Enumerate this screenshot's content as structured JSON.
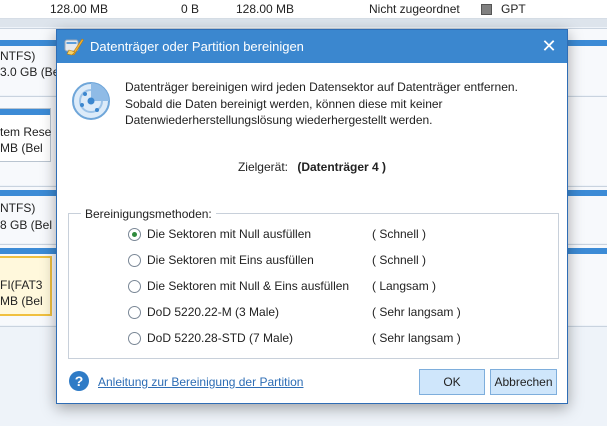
{
  "background": {
    "top_row": {
      "capacity": "128.00 MB",
      "used": "0 B",
      "unused": "128.00 MB",
      "status": "Nicht zugeordnet",
      "type": "GPT"
    },
    "fragments": {
      "ntfs_1": "NTFS)",
      "size_1": "3.0 GB (Bel",
      "reserved": "tem Rese",
      "mb_1": "MB (Bel",
      "ntfs_2": "NTFS)",
      "size_2": "8 GB (Bel",
      "fat": "FI(FAT3",
      "mb_2": "MB (Bel"
    }
  },
  "dialog": {
    "title": "Datenträger oder Partition bereinigen",
    "close_glyph": "✕",
    "message": "Datenträger bereinigen wird jeden Datensektor auf Datenträger entfernen. Sobald die Daten bereinigt werden, können diese mit keiner Datenwiederherstellungslösung wiederhergestellt werden.",
    "target_label": "Zielgerät:",
    "target_value": "(Datenträger 4 )",
    "methods_legend": "Bereinigungsmethoden:",
    "methods": [
      {
        "name": "Die Sektoren mit Null ausfüllen",
        "speed": "( Schnell )",
        "selected": true
      },
      {
        "name": "Die Sektoren mit Eins ausfüllen",
        "speed": "( Schnell )",
        "selected": false
      },
      {
        "name": "Die Sektoren mit Null & Eins ausfüllen",
        "speed": "( Langsam )",
        "selected": false
      },
      {
        "name": "DoD 5220.22-M (3 Male)",
        "speed": "( Sehr langsam )",
        "selected": false
      },
      {
        "name": "DoD 5220.28-STD (7 Male)",
        "speed": "( Sehr langsam )",
        "selected": false
      }
    ],
    "help_glyph": "?",
    "help_link": "Anleitung zur Bereinigung der Partition",
    "ok_label": "OK",
    "cancel_label": "Abbrechen"
  },
  "colors": {
    "titlebar": "#3b87cf",
    "button": "#cfe6fb",
    "link": "#2d6db5",
    "radio_selected": "#2f8a3c"
  }
}
